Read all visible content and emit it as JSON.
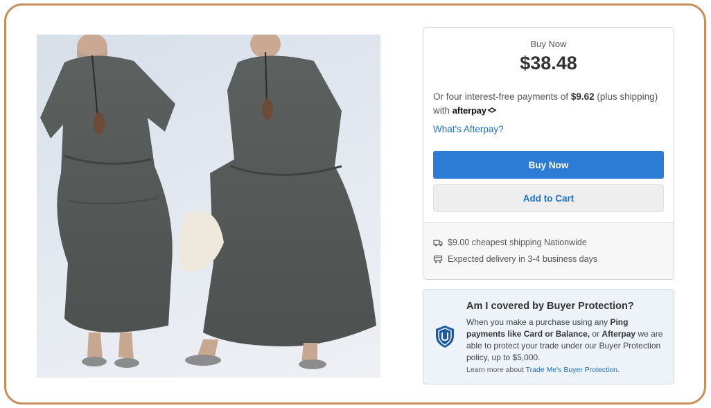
{
  "listing": {
    "image_alt": "Grey layered linen maxi dress worn by model, two views"
  },
  "purchase": {
    "buy_now_label": "Buy Now",
    "price": "$38.48",
    "afterpay": {
      "text_before": "Or four interest-free payments of ",
      "installment": "$9.62",
      "text_after": " (plus shipping) with ",
      "logo_text": "afterpay",
      "logo_icon": "afterpay-arrows-icon",
      "link_label": "What's Afterpay?"
    },
    "buy_now_button": "Buy Now",
    "add_to_cart_button": "Add to Cart",
    "shipping": {
      "cheapest": "$9.00 cheapest shipping Nationwide",
      "cheapest_icon": "truck-icon",
      "delivery": "Expected delivery in 3-4 business days",
      "delivery_icon": "delivery-van-icon"
    }
  },
  "protection": {
    "icon": "shield-check-icon",
    "title": "Am I covered by Buyer Protection?",
    "body_1": "When you make a purchase using any ",
    "body_bold_1": "Ping payments like Card or Balance,",
    "body_2": " or ",
    "body_bold_2": "Afterpay",
    "body_3": " we are able to protect your trade under our Buyer Protection policy, up to $5,000.",
    "learn_more_prefix": "Learn more about ",
    "learn_more_link": "Trade Me's Buyer Protection",
    "learn_more_suffix": "."
  },
  "colors": {
    "frame": "#c98c5b",
    "primary_button": "#2c7bd4",
    "link": "#1f6fc5",
    "protection_bg": "#eef3fa"
  }
}
